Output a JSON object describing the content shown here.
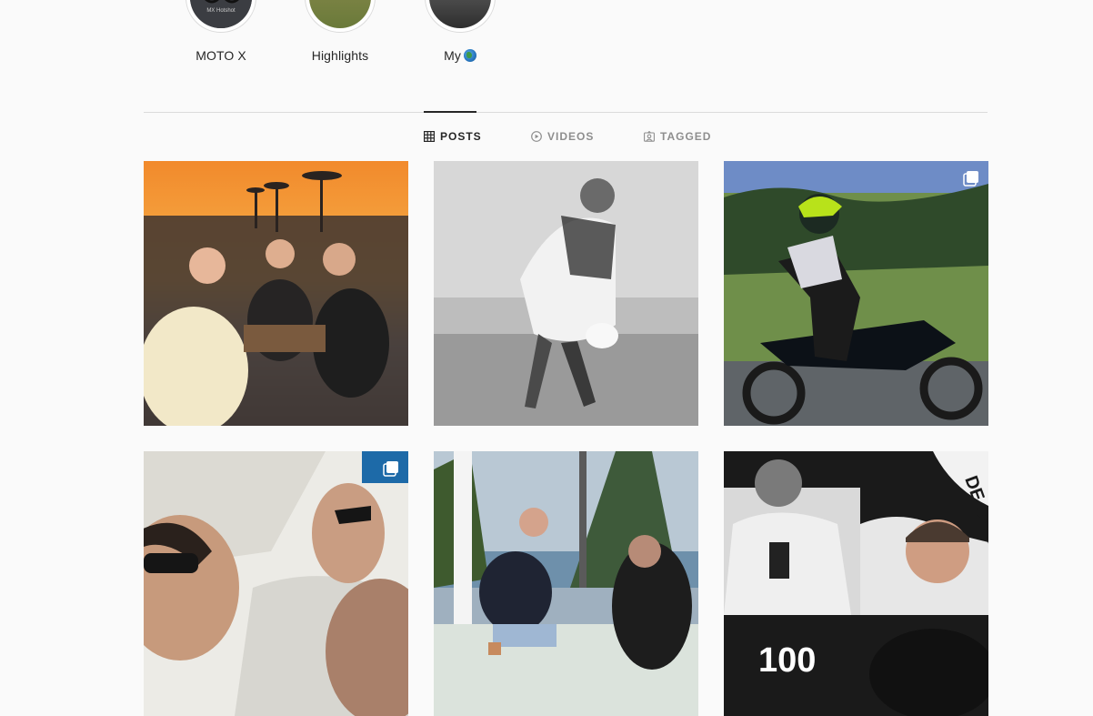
{
  "highlights": [
    {
      "label": "MOTO X",
      "thumb_text": "MX Hotshot"
    },
    {
      "label": "Highlights"
    },
    {
      "label": "My",
      "emoji": "globe"
    }
  ],
  "tabs": [
    {
      "label": "POSTS",
      "icon": "grid-icon",
      "active": true
    },
    {
      "label": "VIDEOS",
      "icon": "play-icon",
      "active": false
    },
    {
      "label": "TAGGED",
      "icon": "tag-icon",
      "active": false
    }
  ],
  "posts": [
    {
      "id": "sunset-dinner",
      "multi": false
    },
    {
      "id": "football-bw",
      "multi": false
    },
    {
      "id": "dirtbike",
      "multi": true
    },
    {
      "id": "selfie-duo",
      "multi": true
    },
    {
      "id": "cafe-chat",
      "multi": false
    },
    {
      "id": "graphic-100",
      "multi": false,
      "overlay_number": "100",
      "overlay_text": "DE GOEY"
    }
  ],
  "colors": {
    "background": "#fafafa",
    "text": "#262626",
    "muted": "#8e8e8e",
    "divider": "#dbdbdb"
  }
}
